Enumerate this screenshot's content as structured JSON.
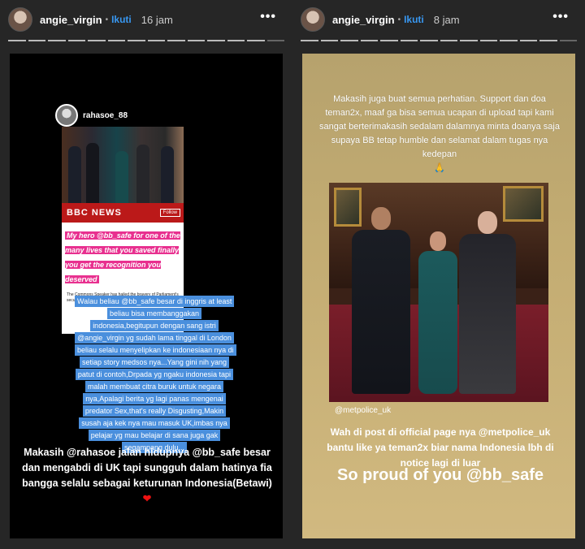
{
  "left": {
    "username": "angie_virgin",
    "follow_label": "Ikuti",
    "time": "16 jam",
    "more": "•••",
    "repost": {
      "username": "rahasoe_88",
      "news_brand": "BBC NEWS",
      "follow_btn": "Follow",
      "quote": "My hero @bb_safe for one of the many lives that you saved finally you get the recognition you deserved",
      "article_snippet": "The Commons Speaker has hailed the bravery of Parliament's security team after they saved a"
    },
    "blue_text": "Walau beliau @bb_safe besar di inggris at least beliau bisa membanggakan indonesia,begitupun dengan sang istri @angie_virgin yg sudah lama tinggal di London beliau selalu menyelipkan ke indonesiaan nya di setiap story medsos nya...Yang gini nih yang patut di contoh,Drpada yg ngaku indonesia tapi malah membuat citra buruk untuk negara nya,Apalagi berita yg lagi panas mengenai predator Sex,that's really Disgusting,Makin susah aja kek nya mau masuk UK,imbas nya pelajar yg mau belajar di sana juga gak segampang dulu...",
    "caption": "Makasih @rahasoe jalan hidupnya @bb_safe besar dan mengabdi di UK tapi sungguh dalam hatinya fia bangga selalu sebagai keturunan Indonesia(Betawi)",
    "heart": "❤"
  },
  "right": {
    "username": "angie_virgin",
    "follow_label": "Ikuti",
    "time": "8 jam",
    "more": "•••",
    "text1": "Makasih juga buat semua perhatian. Support dan doa teman2x, maaf ga bisa semua ucapan di upload tapi kami sangat berterimakasih sedalam dalamnya minta doanya saja supaya BB tetap humble dan selamat dalam tugas nya kedepan",
    "pray": "🙏",
    "watermark": "@metpolice_uk",
    "text2": "Wah di post di official page nya @metpolice_uk  bantu like ya teman2x biar nama Indonesia lbh di notice lagi di luar",
    "text3": "So proud of you @bb_safe"
  }
}
